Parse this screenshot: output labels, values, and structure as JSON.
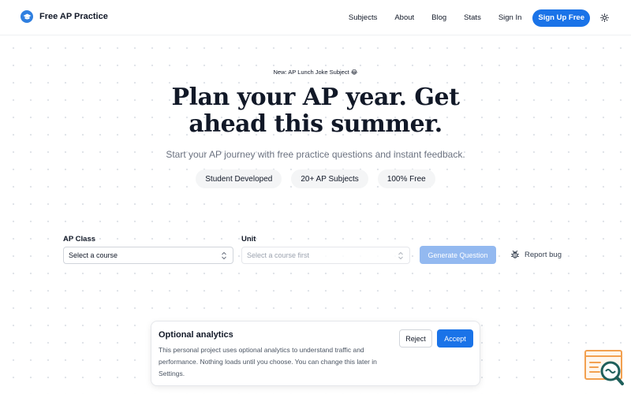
{
  "brand": {
    "name": "Free AP Practice",
    "icon": "graduation-cap-icon"
  },
  "nav": {
    "links": [
      "Subjects",
      "About",
      "Blog",
      "Stats",
      "Sign In"
    ],
    "signup_label": "Sign Up Free",
    "theme_icon": "sun-icon"
  },
  "hero": {
    "badge": "New: AP Lunch Joke Subject 😂",
    "title_line1": "Plan your AP year. Get",
    "title_line2": "ahead this summer.",
    "subtitle": "Start your AP journey with free practice questions and instant feedback.",
    "pills": [
      "Student Developed",
      "20+ AP Subjects",
      "100% Free"
    ]
  },
  "form": {
    "class_label": "AP Class",
    "class_value": "Select a course",
    "unit_label": "Unit",
    "unit_value": "Select a course first",
    "generate_label": "Generate Question",
    "report_label": "Report bug",
    "report_icon": "bug-icon"
  },
  "consent": {
    "title": "Optional analytics",
    "text": "This personal project uses optional analytics to understand traffic and performance. Nothing loads until you choose. You can change this later in Settings.",
    "reject_label": "Reject",
    "accept_label": "Accept"
  },
  "colors": {
    "accent": "#1a73e8",
    "accent_disabled": "#93b9f0",
    "widget_orange": "#f2a04f",
    "widget_teal": "#1f5f5b"
  }
}
